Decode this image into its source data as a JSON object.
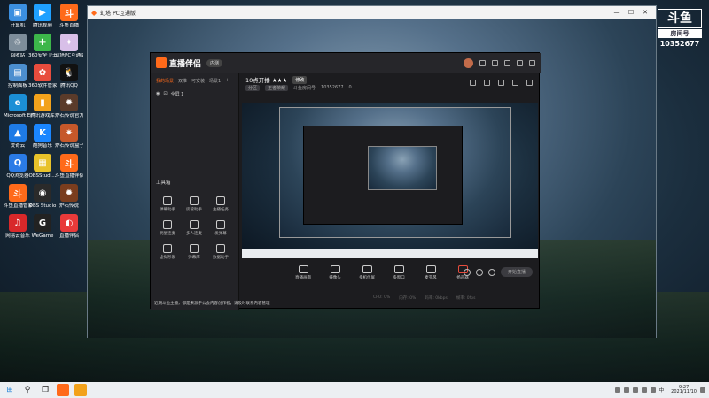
{
  "desktop": {
    "icons": [
      {
        "label": "计算机",
        "color": "#3b8fe0",
        "icon": "computer-icon",
        "glyph": "▣"
      },
      {
        "label": "腾讯视频",
        "color": "#1fa0ff",
        "icon": "play-icon",
        "glyph": "▶"
      },
      {
        "label": "斗鱼直播",
        "color": "#ff6a1a",
        "icon": "douyu-icon",
        "glyph": "斗"
      },
      {
        "label": "回收站",
        "color": "#7d8d9a",
        "icon": "recycle-bin-icon",
        "glyph": "♲"
      },
      {
        "label": "360安全卫士",
        "color": "#3cb64a",
        "icon": "shield-icon",
        "glyph": "✚"
      },
      {
        "label": "幻塔PC互通版",
        "color": "#d8bfe8",
        "icon": "game-icon",
        "glyph": "✦"
      },
      {
        "label": "控制面板",
        "color": "#4c8fcf",
        "icon": "control-panel-icon",
        "glyph": "▤"
      },
      {
        "label": "360软件管家",
        "color": "#e84c3d",
        "icon": "apps-icon",
        "glyph": "✿"
      },
      {
        "label": "腾讯QQ",
        "color": "#111111",
        "icon": "qq-icon",
        "glyph": "🐧"
      },
      {
        "label": "Microsoft Edge",
        "color": "#1b8fd6",
        "icon": "edge-icon",
        "glyph": "e"
      },
      {
        "label": "腾讯游戏库",
        "color": "#f2a21b",
        "icon": "folder-icon",
        "glyph": "▮"
      },
      {
        "label": "炉石传说官方",
        "color": "#5a3b2a",
        "icon": "hearthstone-icon",
        "glyph": "✹"
      },
      {
        "label": "爱奇云",
        "color": "#1e7be6",
        "icon": "cloud-icon",
        "glyph": "▲"
      },
      {
        "label": "酷狗音乐",
        "color": "#1a86ff",
        "icon": "kugou-icon",
        "glyph": "K"
      },
      {
        "label": "炉石传说盒子",
        "color": "#c6582a",
        "icon": "box-icon",
        "glyph": "✷"
      },
      {
        "label": "QQ浏览器",
        "color": "#2a7be6",
        "icon": "browser-icon",
        "glyph": "Q"
      },
      {
        "label": "OBSStudi...",
        "color": "#e8c22a",
        "icon": "obs-file-icon",
        "glyph": "▦"
      },
      {
        "label": "斗鱼直播伴侣",
        "color": "#ff6a1a",
        "icon": "douyu-assistant-icon",
        "glyph": "斗"
      },
      {
        "label": "斗鱼直播管家",
        "color": "#ff6a1a",
        "icon": "douyu-manager-icon",
        "glyph": "斗"
      },
      {
        "label": "OBS Studio",
        "color": "#2a2a2a",
        "icon": "obs-icon",
        "glyph": "◉"
      },
      {
        "label": "炉石传说",
        "color": "#7a3d1e",
        "icon": "hearthstone-app-icon",
        "glyph": "✹"
      },
      {
        "label": "网易云音乐",
        "color": "#d8282a",
        "icon": "netease-music-icon",
        "glyph": "♫"
      },
      {
        "label": "WeGame",
        "color": "#222222",
        "icon": "wegame-icon",
        "glyph": "G"
      },
      {
        "label": "直播伴侣",
        "color": "#e83a3a",
        "icon": "live-assistant-icon",
        "glyph": "◐"
      }
    ]
  },
  "watermark": {
    "logo": "斗鱼",
    "sub": "房间号",
    "room": "10352677"
  },
  "outer_window": {
    "title": "幻塔 PC互通版",
    "min": "—",
    "max": "☐",
    "close": "✕"
  },
  "app": {
    "brand": "直播伴侣",
    "version": "内测",
    "tabs": [
      "我的场景",
      "双推",
      "可安装",
      "场景1"
    ],
    "scene_item": "全屏 1",
    "tool_title": "工具箱",
    "tools": [
      "弹幕助手",
      "房管助手",
      "主播任务",
      "明星连麦",
      "多人连麦",
      "发弹幕",
      "虚拟形象",
      "弹幕库",
      "数据助手"
    ],
    "notice": "近期斗鱼主播，都是来源于公会内容创作者，请及时联系内容管理",
    "stream_title": "10点开播 ★★★",
    "edit_label": "修改",
    "sub": [
      "分区",
      "王者荣耀",
      "斗鱼房间号",
      "10352677",
      "0"
    ],
    "bottom_tools": [
      "直播画面",
      "摄像头",
      "多机位屏",
      "多窗口",
      "麦克风",
      "扬声器"
    ],
    "start_button": "开始直播",
    "stats": [
      "CPU: 0%",
      "内存: 0%",
      "码率: 0kbps",
      "帧率: 0fps"
    ]
  },
  "taskbar": {
    "start": "⊞",
    "search": "⚲",
    "taskview": "❒",
    "tray_lang": "中",
    "time": "9:27",
    "date": "2021/11/10"
  }
}
